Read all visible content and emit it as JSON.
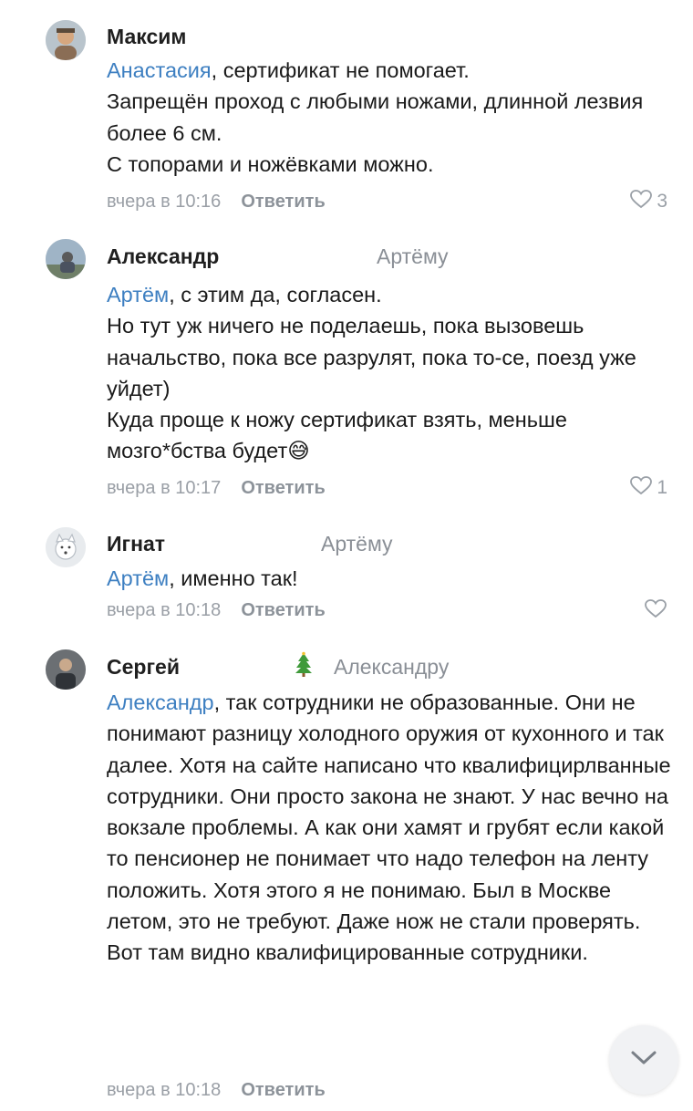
{
  "comments": [
    {
      "author": "Максим",
      "reply_to": "",
      "mention": "Анастасия",
      "text": ", сертификат не помогает.\nЗапрещён проход с любыми ножами, длинной лезвия более 6 см.\nС топорами и ножёвками можно.",
      "emoji": "",
      "time": "вчера в 10:16",
      "reply_label": "Ответить",
      "likes": "3"
    },
    {
      "author": "Александр",
      "reply_to": "Артёму",
      "mention": "Артём",
      "text": ", с этим да, согласен.\nНо тут уж ничего не поделаешь, пока вызовешь начальство, пока все разрулят, пока то-се, поезд уже уйдет)\nКуда проще к ножу сертификат взять, меньше мозго*бства будет",
      "emoji": "😅",
      "time": "вчера в 10:17",
      "reply_label": "Ответить",
      "likes": "1"
    },
    {
      "author": "Игнат",
      "reply_to": "Артёму",
      "mention": "Артём",
      "text": ", именно так!",
      "emoji": "",
      "time": "вчера в 10:18",
      "reply_label": "Ответить",
      "likes": ""
    },
    {
      "author": "Сергей",
      "reply_to": "Александру",
      "mention": "Александр",
      "text": ", так сотрудники не образованные. Они не понимают разницу холодного оружия от кухонного и так далее. Хотя на сайте написано что квалифицирлванные сотрудники. Они просто закона не знают. У нас вечно на вокзале проблемы. А как они хамят и грубят если какой то пенсионер не понимает что надо телефон на ленту положить. Хотя этого я не понимаю. Был в Москве летом, это не требуют. Даже нож не стали проверять. Вот там видно квалифицированные сотрудники.",
      "emoji": "",
      "time": "вчера в 10:18",
      "reply_label": "Ответить",
      "likes": ""
    }
  ],
  "icons": {
    "like": "heart-outline-icon",
    "scroll": "chevron-down-icon",
    "badge": "christmas-tree-icon"
  },
  "colors": {
    "mention": "#3d7fc1",
    "muted": "#9a9fa6"
  }
}
